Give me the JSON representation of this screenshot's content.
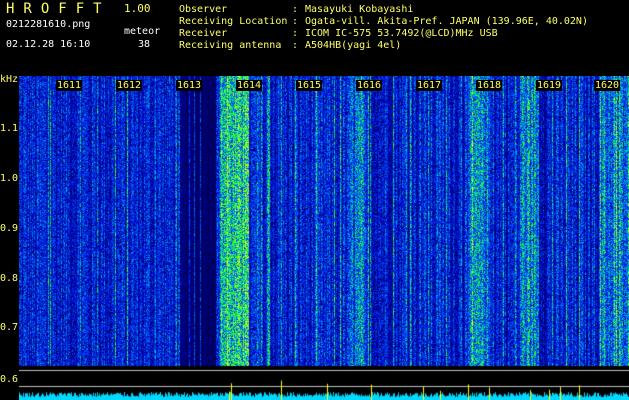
{
  "header": {
    "logo": "HROFFT",
    "version": "1.00",
    "filename": "0212281610.png",
    "datetime": "02.12.28 16:10",
    "meteor_label": "meteor",
    "meteor_count": "38",
    "info": [
      {
        "label": "Observer",
        "value": "Masayuki Kobayashi"
      },
      {
        "label": "Receiving Location",
        "value": "Ogata-vill. Akita-Pref. JAPAN (139.96E, 40.02N)"
      },
      {
        "label": "Receiver",
        "value": "ICOM IC-575 53.7492(@LCD)MHz USB"
      },
      {
        "label": "Receiving antenna",
        "value": "A504HB(yagi 4el)"
      }
    ]
  },
  "spectrogram": {
    "y_unit": "kHz",
    "y_ticks": [
      "1.1",
      "1.0",
      "0.9",
      "0.8",
      "0.7",
      "0.6"
    ],
    "x_ticks": [
      "1611",
      "1612",
      "1613",
      "1614",
      "1615",
      "1616",
      "1617",
      "1618",
      "1619",
      "1620"
    ],
    "colors": {
      "background": "#000000",
      "low": "#00008c",
      "mid": "#1a5aff",
      "high": "#00ff80",
      "peak": "#ffff00",
      "trace": "#00d8ff",
      "text": "#ffff66"
    }
  }
}
